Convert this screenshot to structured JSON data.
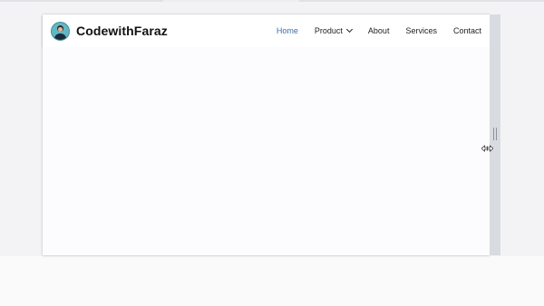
{
  "brand": {
    "name": "CodewithFaraz",
    "avatar_icon": "avatar-icon"
  },
  "nav": {
    "items": [
      {
        "label": "Home",
        "active": true
      },
      {
        "label": "Product",
        "has_dropdown": true,
        "dropdown_icon": "chevron-down-icon"
      },
      {
        "label": "About"
      },
      {
        "label": "Services"
      },
      {
        "label": "Contact"
      }
    ]
  },
  "colors": {
    "active_link": "#3b6ea8",
    "text": "#222222",
    "navbar_bg": "#ffffff",
    "page_bg": "#f3f3f5",
    "resize_bar": "#d9dbe0"
  },
  "cursor": {
    "icon": "horizontal-resize-cursor-icon"
  }
}
